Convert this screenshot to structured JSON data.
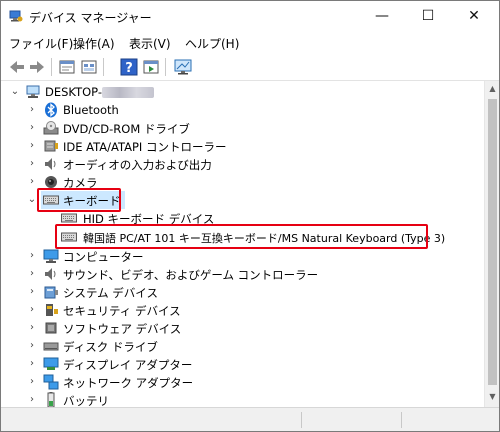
{
  "window": {
    "title": "デバイス マネージャー",
    "controls": {
      "minimize": "—",
      "maximize": "☐",
      "close": "✕"
    }
  },
  "menu": [
    {
      "label": "ファイル(F)"
    },
    {
      "label": "操作(A)"
    },
    {
      "label": "表示(V)"
    },
    {
      "label": "ヘルプ(H)"
    }
  ],
  "toolbar": {
    "icons": [
      "back-icon",
      "forward-icon",
      "properties-icon",
      "show-hidden-icon",
      "help-icon",
      "action-pane-icon",
      "monitor-icon"
    ]
  },
  "tree": {
    "root": {
      "label": "DESKTOP-",
      "redacted": "xxxxxxx"
    },
    "categories": [
      {
        "label": "Bluetooth",
        "icon": "bluetooth-icon"
      },
      {
        "label": "DVD/CD-ROM ドライブ",
        "icon": "dvd-drive-icon"
      },
      {
        "label": "IDE ATA/ATAPI コントローラー",
        "icon": "ide-controller-icon"
      },
      {
        "label": "オーディオの入力および出力",
        "icon": "speaker-icon"
      },
      {
        "label": "カメラ",
        "icon": "camera-icon"
      },
      {
        "label": "キーボード",
        "icon": "keyboard-icon",
        "expanded": true,
        "children": [
          {
            "label": "HID キーボード デバイス",
            "icon": "keyboard-icon"
          },
          {
            "label": "韓国語 PC/AT 101 キー互換キーボード/MS Natural Keyboard (Type 3)",
            "icon": "keyboard-icon"
          }
        ]
      },
      {
        "label": "コンピューター",
        "icon": "computer-icon"
      },
      {
        "label": "サウンド、ビデオ、およびゲーム コントローラー",
        "icon": "sound-icon"
      },
      {
        "label": "システム デバイス",
        "icon": "system-device-icon"
      },
      {
        "label": "セキュリティ デバイス",
        "icon": "security-device-icon"
      },
      {
        "label": "ソフトウェア デバイス",
        "icon": "software-device-icon"
      },
      {
        "label": "ディスク ドライブ",
        "icon": "disk-drive-icon"
      },
      {
        "label": "ディスプレイ アダプター",
        "icon": "display-adapter-icon"
      },
      {
        "label": "ネットワーク アダプター",
        "icon": "network-adapter-icon"
      },
      {
        "label": "バッテリ",
        "icon": "battery-icon"
      }
    ]
  },
  "colors": {
    "highlight_box": "#e60012",
    "selection": "#cce8ff"
  }
}
